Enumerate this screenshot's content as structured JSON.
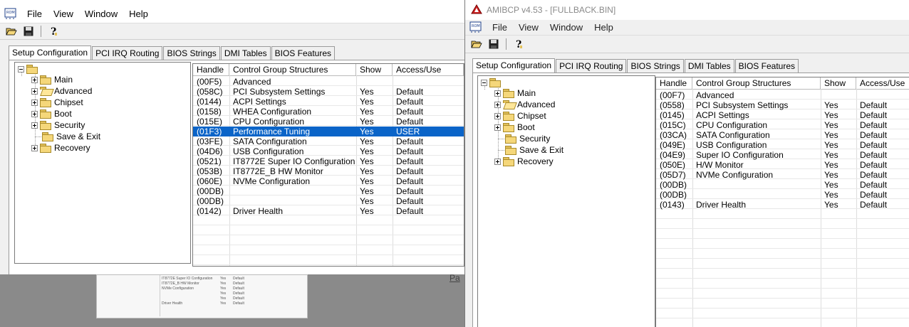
{
  "background": {
    "ghost_rows": [
      [
        "IT8772E Super IO Configuration",
        "Yes",
        "Default"
      ],
      [
        "IT8772E_B HW Monitor",
        "Yes",
        "Default"
      ],
      [
        "NVMe Configuration",
        "Yes",
        "Default"
      ],
      [
        "",
        "Yes",
        "Default"
      ],
      [
        "",
        "Yes",
        "Default"
      ],
      [
        "Driver Health",
        "Yes",
        "Default"
      ]
    ],
    "edge_text": "Pa"
  },
  "window1": {
    "menu": [
      "File",
      "View",
      "Window",
      "Help"
    ],
    "tabs": [
      "Setup Configuration",
      "PCI IRQ Routing",
      "BIOS Strings",
      "DMI Tables",
      "BIOS Features"
    ],
    "tree": [
      "Main",
      "Advanced",
      "Chipset",
      "Boot",
      "Security",
      "Save & Exit",
      "Recovery"
    ],
    "columns": [
      "Handle",
      "Control Group Structures",
      "Show",
      "Access/Use"
    ],
    "rows": [
      [
        "(00F5)",
        "Advanced",
        "",
        ""
      ],
      [
        "(058C)",
        "PCI Subsystem Settings",
        "Yes",
        "Default"
      ],
      [
        "(0144)",
        "ACPI Settings",
        "Yes",
        "Default"
      ],
      [
        "(0158)",
        "WHEA Configuration",
        "Yes",
        "Default"
      ],
      [
        "(015E)",
        "CPU Configuration",
        "Yes",
        "Default"
      ],
      [
        "(01F3)",
        "Performance Tuning",
        "Yes",
        "USER"
      ],
      [
        "(03FE)",
        "SATA Configuration",
        "Yes",
        "Default"
      ],
      [
        "(04D6)",
        "USB Configuration",
        "Yes",
        "Default"
      ],
      [
        "(0521)",
        "IT8772E Super IO Configuration",
        "Yes",
        "Default"
      ],
      [
        "(053B)",
        "IT8772E_B HW Monitor",
        "Yes",
        "Default"
      ],
      [
        "(060E)",
        "NVMe Configuration",
        "Yes",
        "Default"
      ],
      [
        "(00DB)",
        "",
        "Yes",
        "Default"
      ],
      [
        "(00DB)",
        "",
        "Yes",
        "Default"
      ],
      [
        "(0142)",
        "Driver Health",
        "Yes",
        "Default"
      ]
    ],
    "selected_row": 5
  },
  "window2": {
    "title": "AMIBCP v4.53 - [FULLBACK.BIN]",
    "menu": [
      "File",
      "View",
      "Window",
      "Help"
    ],
    "tabs": [
      "Setup Configuration",
      "PCI IRQ Routing",
      "BIOS Strings",
      "DMI Tables",
      "BIOS Features"
    ],
    "tree": [
      "Main",
      "Advanced",
      "Chipset",
      "Boot",
      "Security",
      "Save & Exit",
      "Recovery"
    ],
    "columns": [
      "Handle",
      "Control Group Structures",
      "Show",
      "Access/Use"
    ],
    "rows": [
      [
        "(00F7)",
        "Advanced",
        "",
        ""
      ],
      [
        "(0558)",
        "PCI Subsystem Settings",
        "Yes",
        "Default"
      ],
      [
        "(0145)",
        "ACPI Settings",
        "Yes",
        "Default"
      ],
      [
        "(015C)",
        "CPU Configuration",
        "Yes",
        "Default"
      ],
      [
        "(03CA)",
        "SATA Configuration",
        "Yes",
        "Default"
      ],
      [
        "(049E)",
        "USB Configuration",
        "Yes",
        "Default"
      ],
      [
        "(04E9)",
        "Super IO Configuration",
        "Yes",
        "Default"
      ],
      [
        "(050E)",
        "H/W Monitor",
        "Yes",
        "Default"
      ],
      [
        "(05D7)",
        "NVMe Configuration",
        "Yes",
        "Default"
      ],
      [
        "(00DB)",
        "",
        "Yes",
        "Default"
      ],
      [
        "(00DB)",
        "",
        "Yes",
        "Default"
      ],
      [
        "(0143)",
        "Driver Health",
        "Yes",
        "Default"
      ]
    ]
  }
}
